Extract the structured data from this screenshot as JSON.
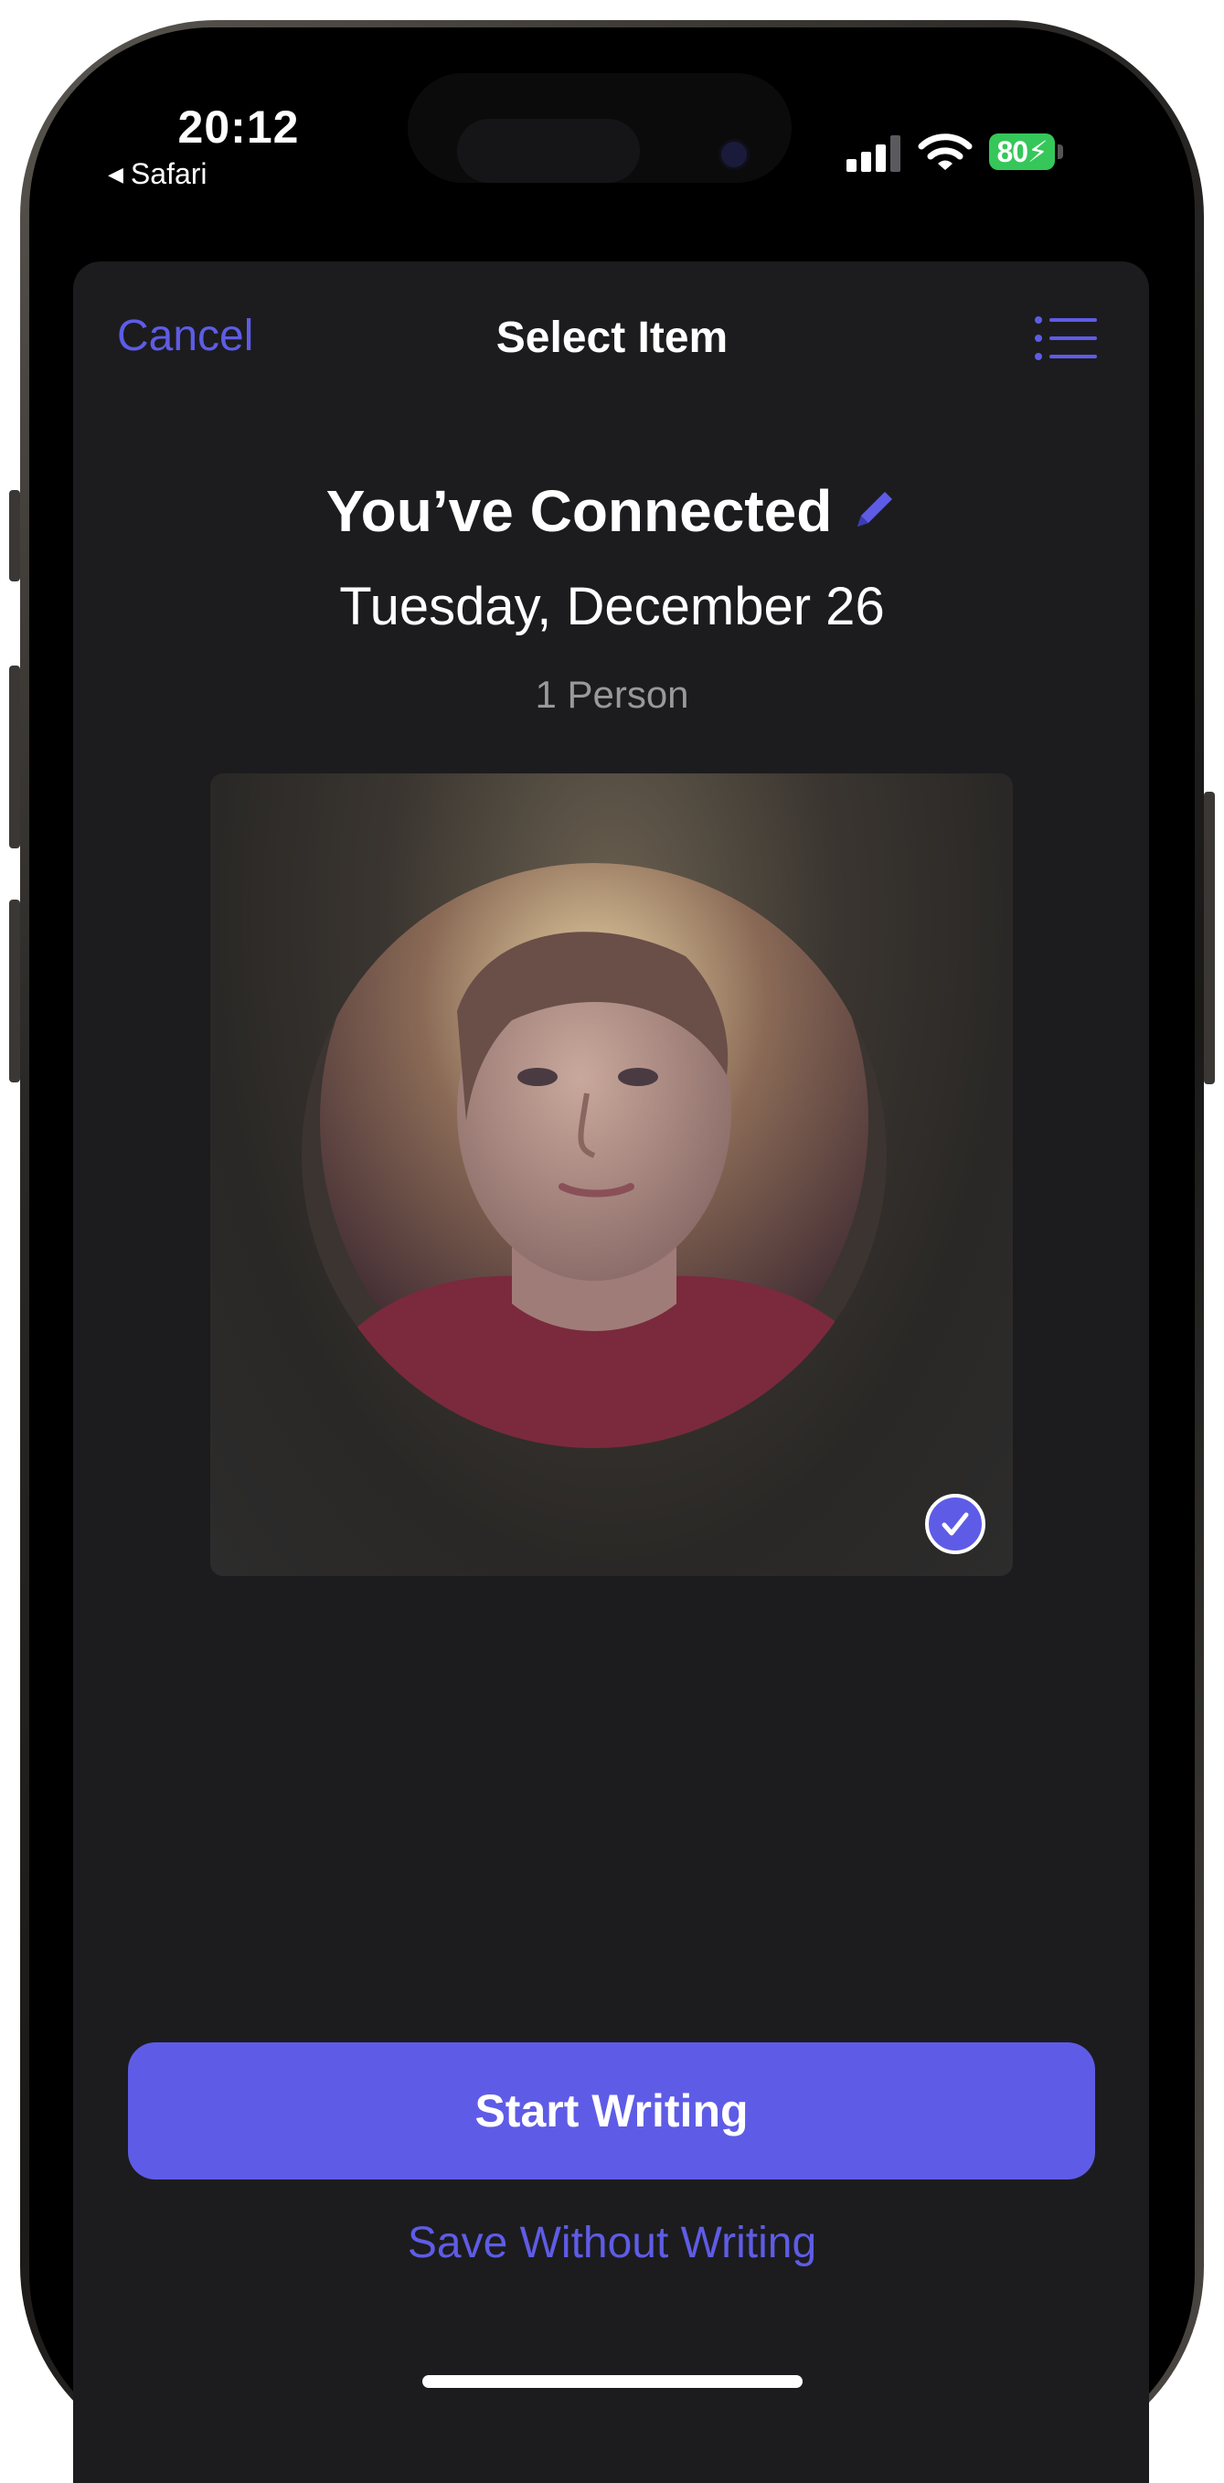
{
  "status_bar": {
    "time": "20:12",
    "back_app": "Safari",
    "battery": "80"
  },
  "nav": {
    "cancel_label": "Cancel",
    "title": "Select Item"
  },
  "entry": {
    "title": "You’ve Connected",
    "date": "Tuesday, December 26",
    "people_count": "1 Person"
  },
  "photo": {
    "selected": true
  },
  "actions": {
    "primary_label": "Start Writing",
    "secondary_label": "Save Without Writing"
  },
  "colors": {
    "accent": "#5e5ce6",
    "sheet_background": "#1c1c1e",
    "secondary_text": "#98989d",
    "battery": "#35c759"
  },
  "icons": {
    "back": "back-triangle-icon",
    "signal": "cellular-signal-icon",
    "wifi": "wifi-icon",
    "battery": "battery-charging-icon",
    "list": "list-icon",
    "edit": "pencil-icon",
    "check": "checkmark-circle-icon"
  }
}
